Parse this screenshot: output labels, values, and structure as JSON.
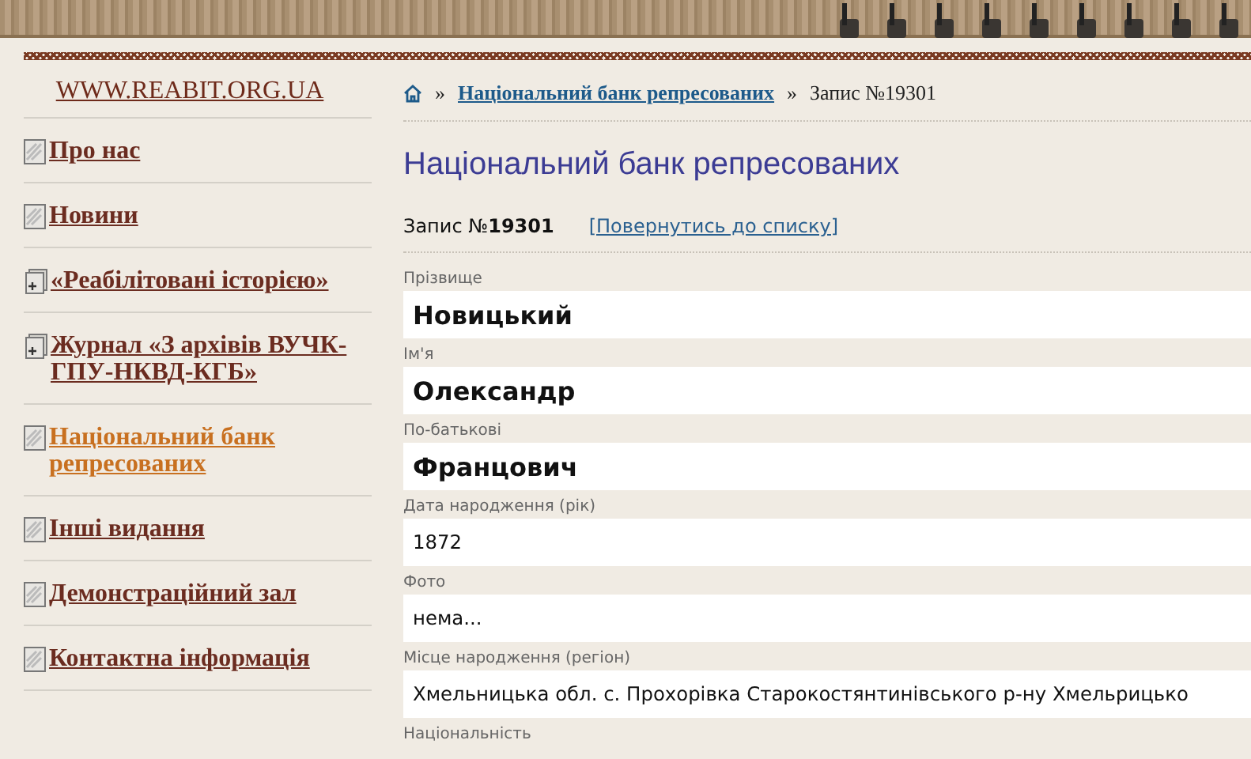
{
  "site_link": "WWW.REABIT.ORG.UA",
  "menu": [
    {
      "label": "Про нас",
      "kind": "page",
      "selected": false
    },
    {
      "label": "Новини",
      "kind": "page",
      "selected": false
    },
    {
      "label": "«Реабілітовані історією»",
      "kind": "folder",
      "selected": false
    },
    {
      "label": "Журнал «З архівів ВУЧК-ГПУ-НКВД-КГБ»",
      "kind": "folder",
      "selected": false
    },
    {
      "label": "Національний банк репресованих",
      "kind": "page",
      "selected": true
    },
    {
      "label": "Інші видання",
      "kind": "page",
      "selected": false
    },
    {
      "label": "Демонстраційний зал",
      "kind": "page",
      "selected": false
    },
    {
      "label": "Контактна інформація",
      "kind": "page",
      "selected": false
    }
  ],
  "breadcrumb": {
    "separator_1": "»",
    "link": "Національний банк репресованих",
    "separator_2": "»",
    "current": "Запис №19301"
  },
  "heading": "Національний банк репресованих",
  "record": {
    "label": "Запис №",
    "number": "19301",
    "back_link": "[Повернутись до списку]"
  },
  "fields": [
    {
      "label": "Прізвище",
      "value": "Новицький",
      "kind": "large"
    },
    {
      "label": "Ім'я",
      "value": "Олександр",
      "kind": "large"
    },
    {
      "label": "По-батькові",
      "value": "Францович",
      "kind": "large"
    },
    {
      "label": "Дата народження (рік)",
      "value": "1872",
      "kind": "normal"
    },
    {
      "label": "Фото",
      "value": "нема...",
      "kind": "normal"
    },
    {
      "label": "Місце народження (регіон)",
      "value": "Хмельницька обл. с. Прохорівка Старокостянтинівського р-ну Хмельрицько",
      "kind": "normal"
    },
    {
      "label": "Національність",
      "kind": "label_only"
    }
  ]
}
